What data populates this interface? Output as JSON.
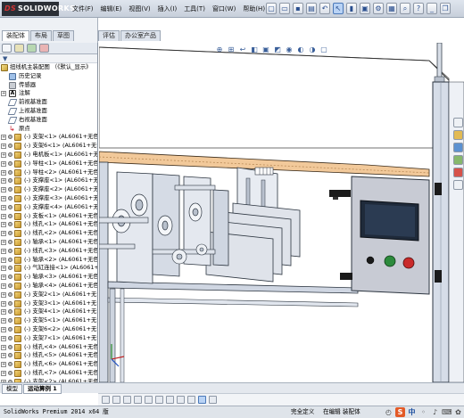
{
  "app": {
    "logo_text": "SOLIDWORKS",
    "logo_mark": "DS"
  },
  "menu": [
    "文件(F)",
    "编辑(E)",
    "视图(V)",
    "插入(I)",
    "工具(T)",
    "窗口(W)",
    "帮助(H)"
  ],
  "command_tabs": [
    "装配体",
    "布局",
    "草图",
    "评估",
    "办公室产品"
  ],
  "feature_tree": {
    "filter_icon": "funnel-icon",
    "root": "扭线机主装配图 （《默认_显示》",
    "items": [
      {
        "icon": "hist",
        "label": "历史记录",
        "expand": false
      },
      {
        "icon": "sens",
        "label": "传感器",
        "expand": false
      },
      {
        "icon": "note",
        "label": "注解",
        "expand": true
      },
      {
        "icon": "plane",
        "label": "前视基准面",
        "expand": false
      },
      {
        "icon": "plane",
        "label": "上视基准面",
        "expand": false
      },
      {
        "icon": "plane",
        "label": "右视基准面",
        "expand": false
      },
      {
        "icon": "orig",
        "label": "原点",
        "expand": false
      },
      {
        "icon": "part",
        "label": "(-) 支架<1> (AL6061+无色",
        "expand": true
      },
      {
        "icon": "part",
        "label": "(-) 支架6<1> (AL6061+无色",
        "expand": true
      },
      {
        "icon": "part",
        "label": "(-) 电机板<1> (AL6061+无色",
        "expand": true
      },
      {
        "icon": "part",
        "label": "(-) 导柱<1> (AL6061+无色",
        "expand": true
      },
      {
        "icon": "part",
        "label": "(-) 导柱<2> (AL6061+无色",
        "expand": true
      },
      {
        "icon": "part",
        "label": "(-) 支撑座<1> (AL6061+无",
        "expand": true
      },
      {
        "icon": "part",
        "label": "(-) 支撑座<2> (AL6061+无",
        "expand": true
      },
      {
        "icon": "part",
        "label": "(-) 支撑座<3> (AL6061+无",
        "expand": true
      },
      {
        "icon": "part",
        "label": "(-) 支撑座<4> (AL6061+无",
        "expand": true
      },
      {
        "icon": "part",
        "label": "(-) 支板<1> (AL6061+无色",
        "expand": true
      },
      {
        "icon": "part",
        "label": "(-) 线孔<1> (AL6061+无色",
        "expand": true
      },
      {
        "icon": "part",
        "label": "(-) 线孔<2> (AL6061+无色",
        "expand": true
      },
      {
        "icon": "part",
        "label": "(-) 轴承<1> (AL6061+无色",
        "expand": true
      },
      {
        "icon": "part",
        "label": "(-) 线孔<3> (AL6061+无色",
        "expand": true
      },
      {
        "icon": "part",
        "label": "(-) 轴承<2> (AL6061+无色",
        "expand": true
      },
      {
        "icon": "part",
        "label": "(-) 气缸连接<1> (AL6061+无",
        "expand": true
      },
      {
        "icon": "part",
        "label": "(-) 轴承<3> (AL6061+无色",
        "expand": true
      },
      {
        "icon": "part",
        "label": "(-) 轴承<4> (AL6061+无色",
        "expand": true
      },
      {
        "icon": "part",
        "label": "(-) 支架2<1> (AL6061+无色",
        "expand": true
      },
      {
        "icon": "part",
        "label": "(-) 支架3<1> (AL6061+无色",
        "expand": true
      },
      {
        "icon": "part",
        "label": "(-) 支架4<1> (AL6061+无色",
        "expand": true
      },
      {
        "icon": "part",
        "label": "(-) 支架5<1> (AL6061+无色",
        "expand": true
      },
      {
        "icon": "part",
        "label": "(-) 支架6<2> (AL6061+无色",
        "expand": true
      },
      {
        "icon": "part",
        "label": "(-) 支架7<1> (AL6061+无色",
        "expand": true
      },
      {
        "icon": "part",
        "label": "(-) 线孔<4> (AL6061+无色",
        "expand": true
      },
      {
        "icon": "part",
        "label": "(-) 线孔<5> (AL6061+无色",
        "expand": true
      },
      {
        "icon": "part",
        "label": "(-) 线孔<6> (AL6061+无色",
        "expand": true
      },
      {
        "icon": "part",
        "label": "(-) 线孔<7> (AL6061+无色",
        "expand": true
      },
      {
        "icon": "part",
        "label": "(-) 支架<2> (AL6061+无色",
        "expand": true
      }
    ]
  },
  "bottom_tabs": [
    "模型",
    "运动算例 1"
  ],
  "status": {
    "app": "SolidWorks Premium 2014 x64 版",
    "definition": "完全定义",
    "editing": "在编辑 装配体"
  },
  "colors": {
    "frame": "#cfd6e2",
    "frame_edge": "#2c3540",
    "wood": "#f2c99a",
    "panel": "#c8cbd4",
    "screen": "#1f2a3a",
    "btn_green": "#2c8a3c",
    "btn_red": "#c92a2a",
    "btn_black": "#1a1a1a"
  }
}
